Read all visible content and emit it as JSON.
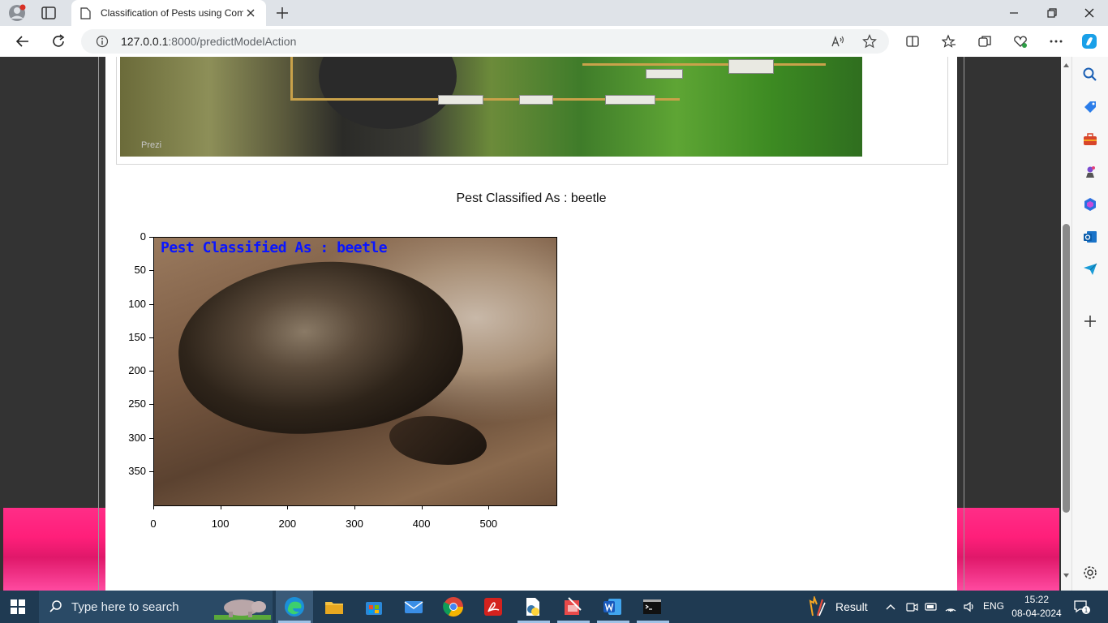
{
  "browser": {
    "tab_title": "Classification of Pests using Com",
    "url_host": "127.0.0.1",
    "url_path": ":8000/predictModelAction"
  },
  "page": {
    "top_image_watermark": "Prezi",
    "result_text": "Pest Classified As : beetle",
    "overlay_text": "Pest Classified As : beetle",
    "plot": {
      "y_ticks": [
        "0",
        "50",
        "100",
        "150",
        "200",
        "250",
        "300",
        "350"
      ],
      "x_ticks": [
        "0",
        "100",
        "200",
        "300",
        "400",
        "500"
      ]
    }
  },
  "taskbar": {
    "search_placeholder": "Type here to search",
    "weather_label": "Result",
    "language": "ENG",
    "time": "15:22",
    "date": "08-04-2024",
    "notification_count": "1"
  },
  "colors": {
    "overlay_text": "#0a16ff",
    "side_pink": "#ff2d87",
    "taskbar": "#1f3a52"
  }
}
